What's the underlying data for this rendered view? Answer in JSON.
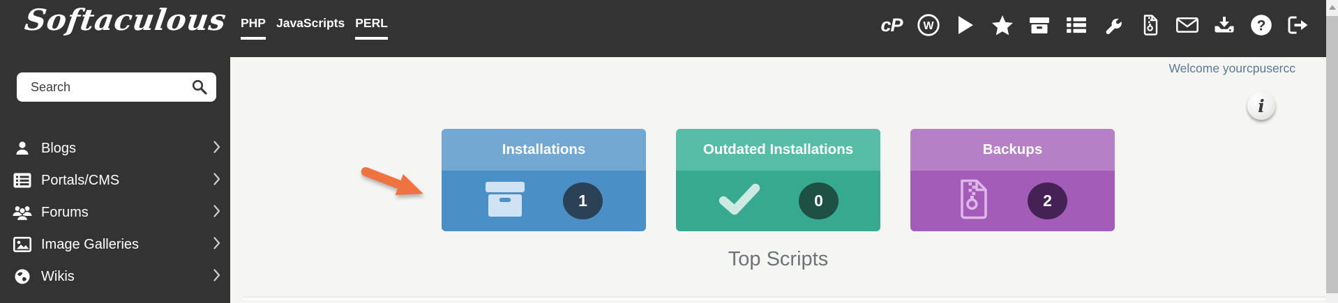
{
  "brand": {
    "logo": "Softaculous"
  },
  "topnav": [
    {
      "label": "PHP",
      "underlined": true
    },
    {
      "label": "JavaScripts",
      "underlined": false
    },
    {
      "label": "PERL",
      "underlined": true
    }
  ],
  "topbar_icons": {
    "cpanel_logo_text": "cP",
    "names": [
      "cpanel",
      "wordpress",
      "play",
      "star",
      "archive-box",
      "list",
      "wrench",
      "zip-file",
      "envelope",
      "download",
      "help",
      "sign-out"
    ]
  },
  "sidebar": {
    "search": {
      "placeholder": "Search"
    },
    "items": [
      {
        "label": "Blogs",
        "icon": "user"
      },
      {
        "label": "Portals/CMS",
        "icon": "list-card"
      },
      {
        "label": "Forums",
        "icon": "users"
      },
      {
        "label": "Image Galleries",
        "icon": "image"
      },
      {
        "label": "Wikis",
        "icon": "globe"
      }
    ]
  },
  "main": {
    "welcome": "Welcome yourcpusercc",
    "section_title": "Top Scripts",
    "cards": [
      {
        "title": "Installations",
        "count": "1",
        "icon": "archive-box",
        "header_color": "#72a8d2",
        "body_color": "#4a8fc6",
        "badge_color": "#2a4156"
      },
      {
        "title": "Outdated Installations",
        "count": "0",
        "icon": "check",
        "header_color": "#58bda7",
        "body_color": "#37a98e",
        "badge_color": "#1e5044"
      },
      {
        "title": "Backups",
        "count": "2",
        "icon": "zip-file",
        "header_color": "#b680c7",
        "body_color": "#a35cb7",
        "badge_color": "#452256"
      }
    ],
    "annotation_arrow_color": "#ee7340"
  },
  "colors": {
    "topbar_bg": "#333333",
    "sidebar_bg": "#333333",
    "content_bg": "#f5f5f4",
    "welcome_text": "#5a7894",
    "section_title_text": "#6e7377"
  }
}
